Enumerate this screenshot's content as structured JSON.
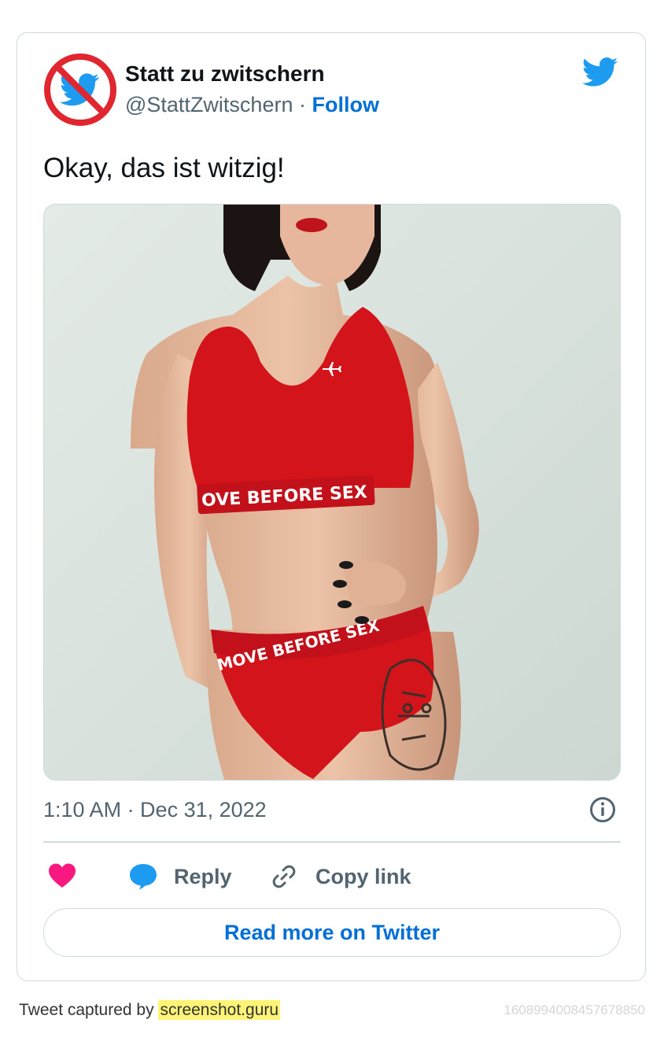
{
  "author": {
    "name": "Statt zu zwitschern",
    "handle": "@StattZwitschern",
    "separator": "·",
    "follow_label": "Follow"
  },
  "tweet": {
    "text": "Okay, das ist witzig!",
    "media_alt": "Photo of a woman wearing red underwear with waistband text",
    "media_text": {
      "top_band": "OVE BEFORE SEX",
      "bottom_band": "MOVE BEFORE SEX"
    },
    "timestamp": "1:10 AM · Dec 31, 2022"
  },
  "actions": {
    "reply_label": "Reply",
    "copy_label": "Copy link",
    "read_more_label": "Read more on Twitter"
  },
  "footer": {
    "captured_prefix": "Tweet captured by",
    "captured_site": "screenshot.guru",
    "tweet_id": "1608994008457678850"
  },
  "colors": {
    "link_blue": "#006fd6",
    "twitter_blue": "#1d9bf0",
    "heart_pink": "#f91880",
    "border": "#cfd9de",
    "muted_text": "#536471",
    "highlight": "#fff475"
  },
  "icons": {
    "avatar": "no-bird-icon",
    "brand": "twitter-bird-icon",
    "info": "info-icon",
    "like": "heart-icon",
    "reply": "speech-bubble-icon",
    "copy": "link-icon"
  }
}
